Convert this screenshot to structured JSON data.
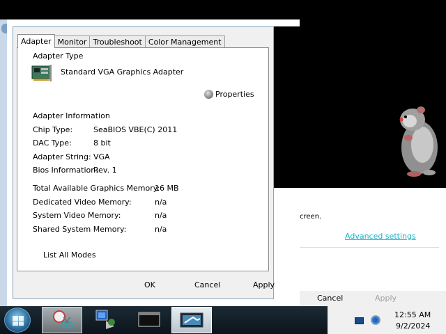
{
  "dialog": {
    "tabs": [
      {
        "label": "Adapter",
        "active": true
      },
      {
        "label": "Monitor",
        "active": false
      },
      {
        "label": "Troubleshoot",
        "active": false
      },
      {
        "label": "Color Management",
        "active": false
      }
    ],
    "adapter_type_heading": "Adapter Type",
    "adapter_name": "Standard VGA Graphics Adapter",
    "properties_label": "Properties",
    "adapter_info_heading": "Adapter Information",
    "info": {
      "chip_type_label": "Chip Type:",
      "chip_type_value": "SeaBIOS VBE(C) 2011",
      "dac_type_label": "DAC Type:",
      "dac_type_value": "8 bit",
      "adapter_string_label": "Adapter String:",
      "adapter_string_value": "VGA",
      "bios_label": "Bios Information:",
      "bios_value": "Rev. 1"
    },
    "memory": {
      "total_label": "Total Available Graphics Memory:",
      "total_value": "16 MB",
      "dedicated_label": "Dedicated Video Memory:",
      "dedicated_value": "n/a",
      "system_label": "System Video Memory:",
      "system_value": "n/a",
      "shared_label": "Shared System Memory:",
      "shared_value": "n/a"
    },
    "list_all_modes_label": "List All Modes",
    "ok_label": "OK",
    "cancel_label": "Cancel",
    "apply_label": "Apply"
  },
  "background_window": {
    "partial_text": "creen.",
    "advanced_settings_link": "Advanced settings",
    "cancel_label": "Cancel",
    "apply_label": "Apply"
  },
  "taskbar": {
    "clock_time": "12:55 AM",
    "clock_date": "9/2/2024"
  },
  "colors": {
    "link": "#1ab0c8",
    "dialog_border": "#8aa6c2",
    "taskbar": "#0b141c"
  }
}
